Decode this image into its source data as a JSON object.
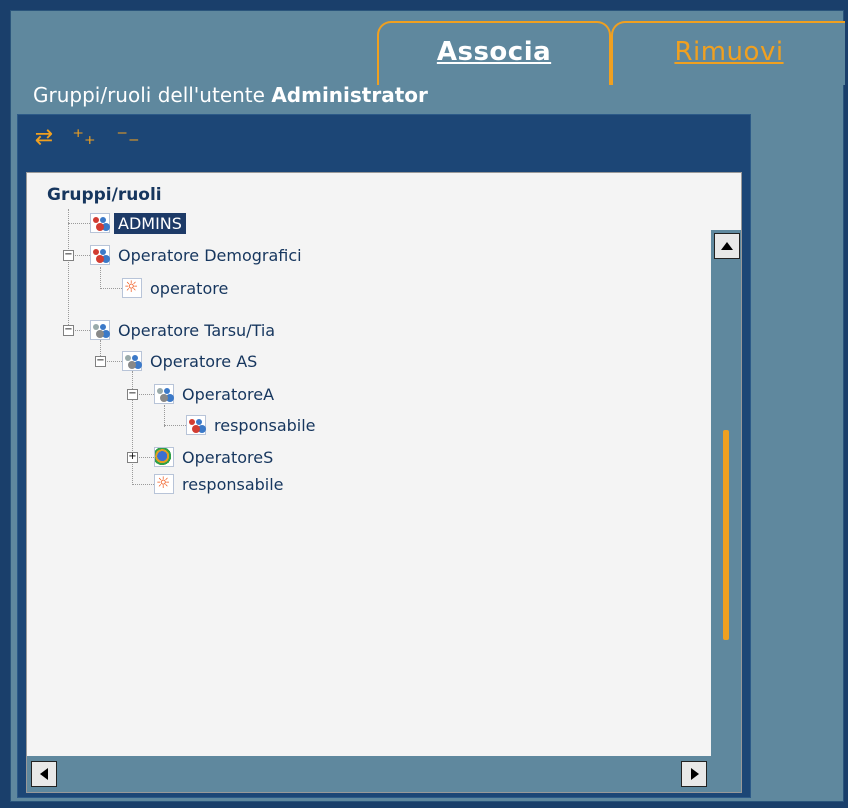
{
  "tabs": [
    {
      "label": "Associa",
      "active": true
    },
    {
      "label": "Rimuovi",
      "active": false
    }
  ],
  "header": {
    "prefix": "Gruppi/ruoli dell'utente",
    "user": "Administrator"
  },
  "toolbar": {
    "refresh_icon": "refresh-icon",
    "expand_icon": "expand-all-icon",
    "collapse_icon": "collapse-all-icon"
  },
  "tree": {
    "title": "Gruppi/ruoli",
    "nodes": [
      {
        "label": "ADMINS",
        "type": "group",
        "selected": true
      },
      {
        "label": "Operatore Demografici",
        "type": "group",
        "expanded": true
      },
      {
        "label": "operatore",
        "type": "role"
      },
      {
        "label": "Operatore Tarsu/Tia",
        "type": "group",
        "expanded": true
      },
      {
        "label": "Operatore AS",
        "type": "group",
        "expanded": true
      },
      {
        "label": "OperatoreA",
        "type": "group",
        "expanded": true
      },
      {
        "label": "responsabile",
        "type": "group"
      },
      {
        "label": "OperatoreS",
        "type": "group",
        "expanded": false
      },
      {
        "label": "responsabile",
        "type": "role"
      }
    ]
  },
  "colors": {
    "accent": "#f0a020",
    "panel": "#1c4676",
    "background": "#5f889e",
    "selection": "#1d3a67"
  }
}
